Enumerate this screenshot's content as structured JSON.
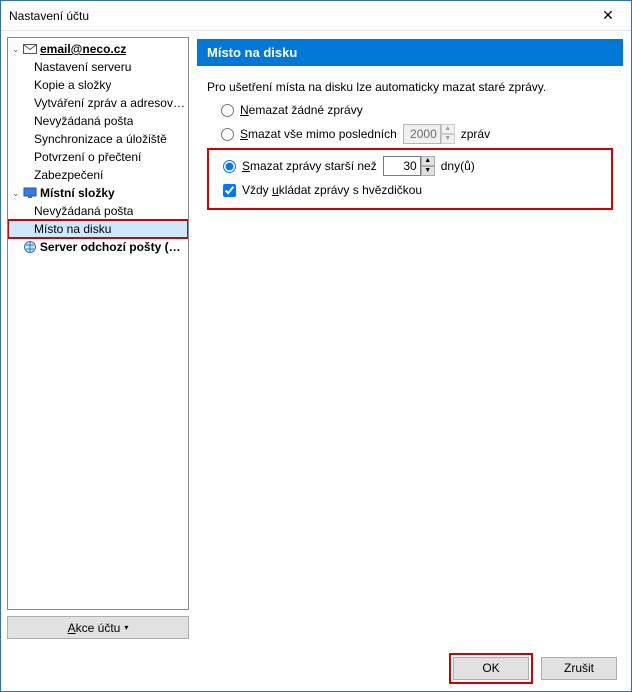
{
  "window": {
    "title": "Nastavení účtu"
  },
  "tree": {
    "account_label": "email@neco.cz",
    "items": [
      "Nastavení serveru",
      "Kopie a složky",
      "Vytváření zpráv a adresování",
      "Nevyžádaná pošta",
      "Synchronizace a úložiště",
      "Potvrzení o přečtení",
      "Zabezpečení"
    ],
    "local_folders_label": "Místní složky",
    "local_children": [
      "Nevyžádaná pošta",
      "Místo na disku"
    ],
    "outgoing_label": "Server odchozí pošty (S..."
  },
  "account_actions_label": "Akce účtu",
  "account_actions_underline": "A",
  "panel": {
    "header": "Místo na disku",
    "intro": "Pro ušetření místa na disku lze automaticky mazat staré zprávy.",
    "radio_none_u": "N",
    "radio_none_rest": "emazat žádné zprávy",
    "radio_recent_u": "S",
    "radio_recent_rest": "mazat vše mimo posledních",
    "recent_value": "2000",
    "recent_unit": "zpráv",
    "radio_older_u": "S",
    "radio_older_rest": "mazat zprávy starší než",
    "older_value": "30",
    "older_unit": "dny(ů)",
    "check_star_pre": "Vždy ",
    "check_star_u": "u",
    "check_star_rest": "kládat zprávy s hvězdičkou"
  },
  "footer": {
    "ok": "OK",
    "cancel": "Zrušit"
  }
}
